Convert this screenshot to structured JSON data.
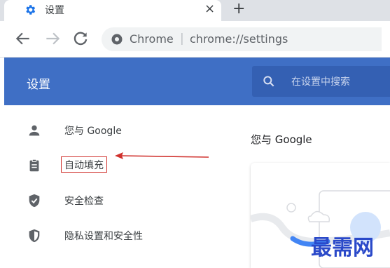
{
  "browser": {
    "tab_title": "设置",
    "tab_close": "×",
    "new_tab": "+",
    "omnibox_site": "Chrome",
    "omnibox_separator": "|",
    "omnibox_url": "chrome://settings"
  },
  "header": {
    "title": "设置",
    "search_placeholder": "在设置中搜索"
  },
  "sidebar": {
    "items": [
      {
        "label": "您与 Google",
        "icon": "person-icon"
      },
      {
        "label": "自动填充",
        "icon": "clipboard-icon",
        "highlighted": true
      },
      {
        "label": "安全检查",
        "icon": "shield-check-icon"
      },
      {
        "label": "隐私设置和安全性",
        "icon": "shield-half-icon"
      }
    ]
  },
  "main": {
    "heading": "您与 Google"
  },
  "colors": {
    "header_bg": "#3f6fc5",
    "annotation": "#d0312d",
    "watermark": "#2a49c9"
  },
  "watermark_text": "最需网"
}
